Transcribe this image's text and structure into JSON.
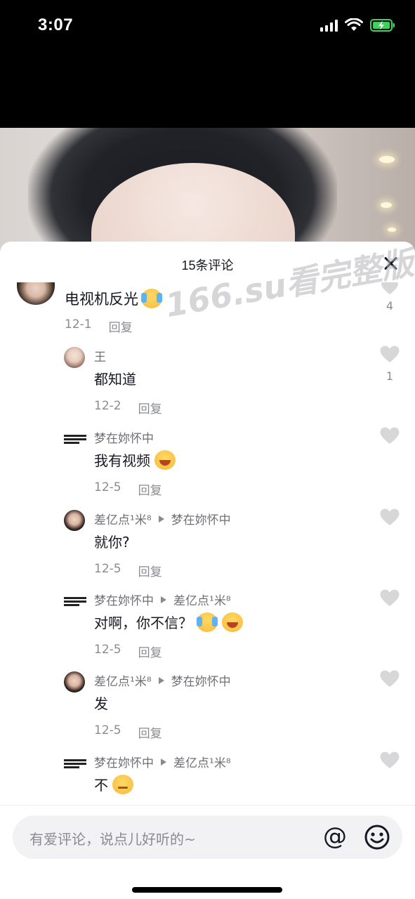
{
  "status_bar": {
    "time": "3:07",
    "icons": [
      "signal-icon",
      "wifi-icon",
      "battery-charging-icon"
    ],
    "battery_color": "#3ad45a"
  },
  "comments_panel": {
    "title": "15条评论",
    "close_icon": "close-icon"
  },
  "watermark": "166.su看完整版",
  "top_comment": {
    "text": "电视机反光",
    "emoji": "cry-laugh-emoji",
    "date": "12-1",
    "reply_label": "回复",
    "like_count": "4"
  },
  "replies": [
    {
      "author": "王",
      "reply_to": "",
      "text": "都知道",
      "emoji": "",
      "date": "12-2",
      "reply_label": "回复",
      "like_count": "1"
    },
    {
      "author": "梦在妳怀中",
      "reply_to": "",
      "text": "我有视频",
      "emoji": "grin-emoji",
      "date": "12-5",
      "reply_label": "回复",
      "like_count": ""
    },
    {
      "author": "差亿点¹米⁸",
      "reply_to": "梦在妳怀中",
      "text": "就你?",
      "emoji": "",
      "date": "12-5",
      "reply_label": "回复",
      "like_count": ""
    },
    {
      "author": "梦在妳怀中",
      "reply_to": "差亿点¹米⁸",
      "text": "对啊，你不信？",
      "emoji": "cry-laugh-emoji grin-emoji",
      "date": "12-5",
      "reply_label": "回复",
      "like_count": ""
    },
    {
      "author": "差亿点¹米⁸",
      "reply_to": "梦在妳怀中",
      "text": "发",
      "emoji": "",
      "date": "12-5",
      "reply_label": "回复",
      "like_count": ""
    },
    {
      "author": "梦在妳怀中",
      "reply_to": "差亿点¹米⁸",
      "text": "不",
      "emoji": "smirk-emoji",
      "date": "",
      "reply_label": "",
      "like_count": ""
    }
  ],
  "input": {
    "placeholder": "有爱评论，说点儿好听的~",
    "at_symbol": "@",
    "emoji_icon": "smiley-icon"
  }
}
